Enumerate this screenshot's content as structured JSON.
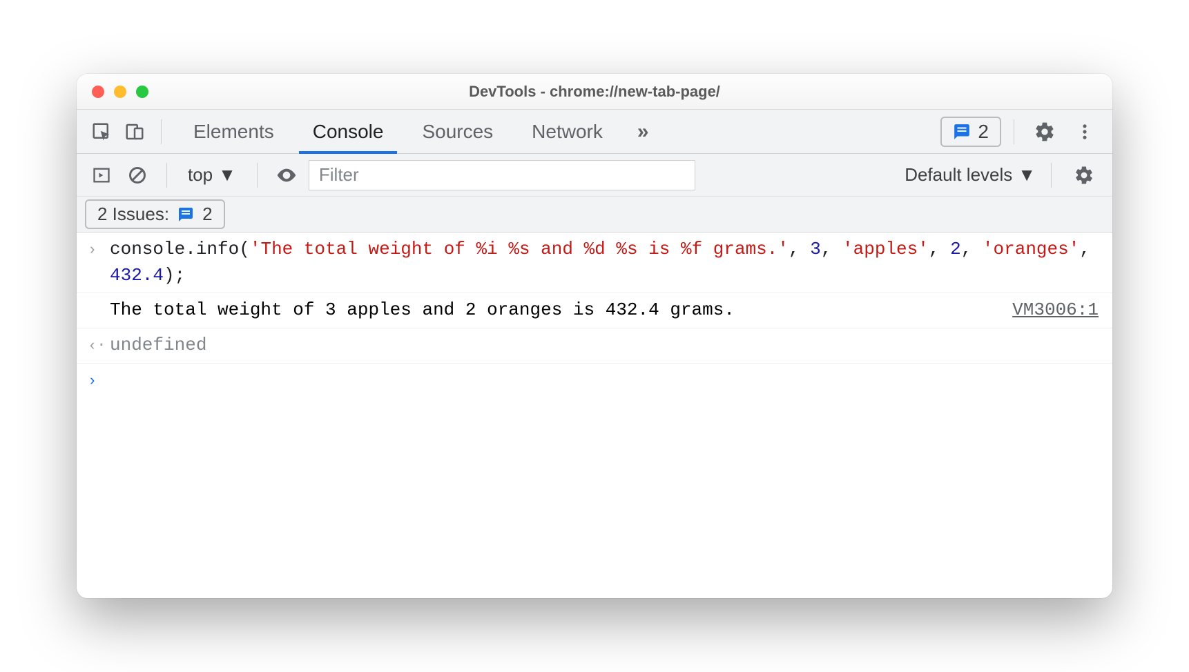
{
  "window": {
    "title": "DevTools - chrome://new-tab-page/"
  },
  "tabs": {
    "items": [
      "Elements",
      "Console",
      "Sources",
      "Network"
    ],
    "active_index": 1,
    "overflow_glyph": "»"
  },
  "header": {
    "issues_badge_count": "2"
  },
  "console_toolbar": {
    "context": "top",
    "filter_placeholder": "Filter",
    "levels_label": "Default levels"
  },
  "issues_row": {
    "label": "2 Issues:",
    "count": "2"
  },
  "console": {
    "input": {
      "segments": [
        {
          "t": "console",
          "c": "tok-method"
        },
        {
          "t": ".",
          "c": "tok-punct"
        },
        {
          "t": "info",
          "c": "tok-method"
        },
        {
          "t": "(",
          "c": "tok-punct"
        },
        {
          "t": "'The total weight of %i %s and %d %s is %f grams.'",
          "c": "tok-str"
        },
        {
          "t": ", ",
          "c": "tok-punct"
        },
        {
          "t": "3",
          "c": "tok-num"
        },
        {
          "t": ", ",
          "c": "tok-punct"
        },
        {
          "t": "'apples'",
          "c": "tok-str"
        },
        {
          "t": ", ",
          "c": "tok-punct"
        },
        {
          "t": "2",
          "c": "tok-num"
        },
        {
          "t": ", ",
          "c": "tok-punct"
        },
        {
          "t": "'oranges'",
          "c": "tok-str"
        },
        {
          "t": ", ",
          "c": "tok-punct"
        },
        {
          "t": "432.4",
          "c": "tok-num"
        },
        {
          "t": ");",
          "c": "tok-punct"
        }
      ]
    },
    "output": {
      "text": "The total weight of 3 apples and 2 oranges is 432.4 grams.",
      "source": "VM3006:1"
    },
    "return_value": "undefined"
  }
}
